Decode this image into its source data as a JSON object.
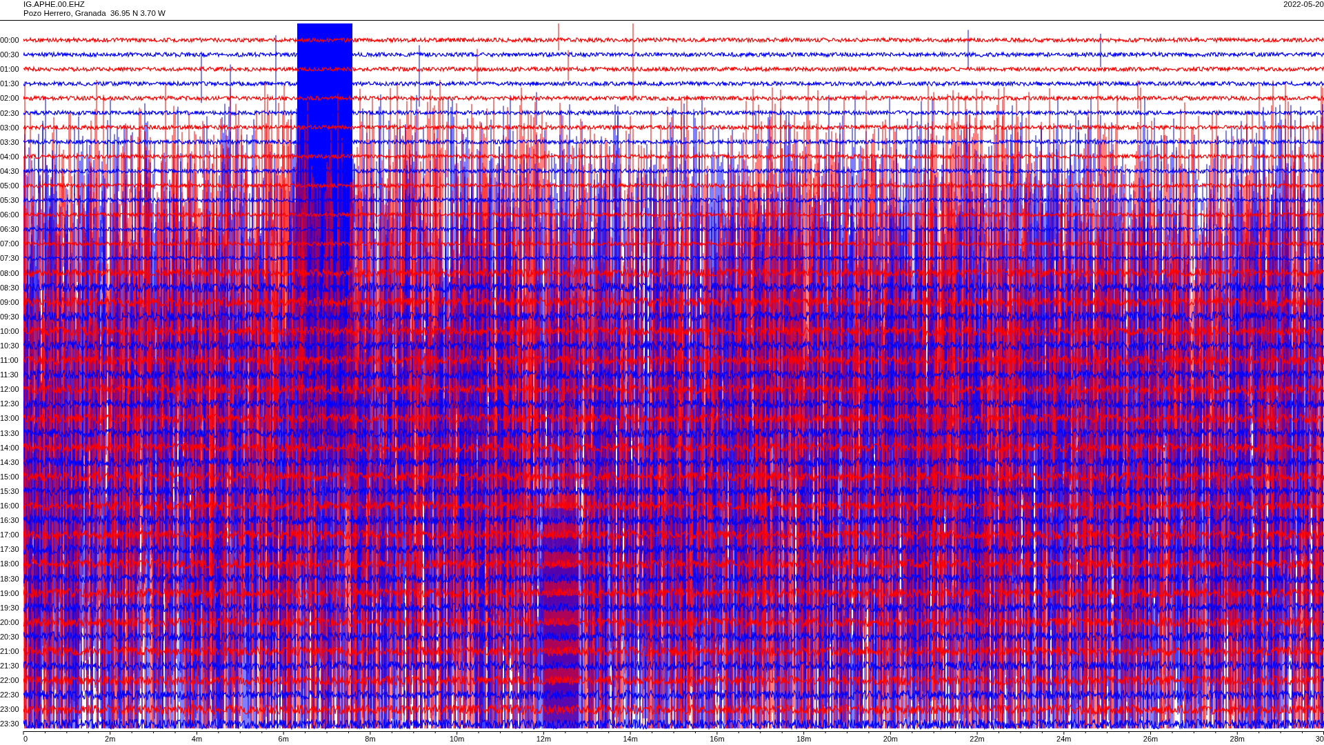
{
  "header": {
    "station": "IG.APHE.00.EHZ",
    "location": "Pozo Herrero, Granada  36.95 N 3.70 W",
    "date": "2022-05-20"
  },
  "traces": [
    {
      "time": "00:00",
      "color": "#ff0000"
    },
    {
      "time": "00:30",
      "color": "#0000ff"
    },
    {
      "time": "01:00",
      "color": "#ff0000"
    },
    {
      "time": "01:30",
      "color": "#0000ff"
    },
    {
      "time": "02:00",
      "color": "#ff0000"
    },
    {
      "time": "02:30",
      "color": "#0000ff"
    },
    {
      "time": "03:00",
      "color": "#ff0000"
    },
    {
      "time": "03:30",
      "color": "#0000ff"
    },
    {
      "time": "04:00",
      "color": "#ff0000"
    },
    {
      "time": "04:30",
      "color": "#0000ff"
    },
    {
      "time": "05:00",
      "color": "#ff0000"
    },
    {
      "time": "05:30",
      "color": "#0000ff"
    },
    {
      "time": "06:00",
      "color": "#ff0000"
    },
    {
      "time": "06:30",
      "color": "#0000ff"
    },
    {
      "time": "07:00",
      "color": "#ff0000"
    },
    {
      "time": "07:30",
      "color": "#0000ff"
    },
    {
      "time": "08:00",
      "color": "#ff0000"
    },
    {
      "time": "08:30",
      "color": "#0000ff"
    },
    {
      "time": "09:00",
      "color": "#ff0000"
    },
    {
      "time": "09:30",
      "color": "#0000ff"
    },
    {
      "time": "10:00",
      "color": "#ff0000"
    },
    {
      "time": "10:30",
      "color": "#0000ff"
    },
    {
      "time": "11:00",
      "color": "#ff0000"
    },
    {
      "time": "11:30",
      "color": "#0000ff"
    },
    {
      "time": "12:00",
      "color": "#ff0000"
    },
    {
      "time": "12:30",
      "color": "#0000ff"
    },
    {
      "time": "13:00",
      "color": "#ff0000"
    },
    {
      "time": "13:30",
      "color": "#0000ff"
    },
    {
      "time": "14:00",
      "color": "#ff0000"
    },
    {
      "time": "14:30",
      "color": "#0000ff"
    },
    {
      "time": "15:00",
      "color": "#ff0000"
    },
    {
      "time": "15:30",
      "color": "#0000ff"
    },
    {
      "time": "16:00",
      "color": "#ff0000"
    },
    {
      "time": "16:30",
      "color": "#0000ff"
    },
    {
      "time": "17:00",
      "color": "#ff0000"
    },
    {
      "time": "17:30",
      "color": "#0000ff"
    },
    {
      "time": "18:00",
      "color": "#ff0000"
    },
    {
      "time": "18:30",
      "color": "#0000ff"
    },
    {
      "time": "19:00",
      "color": "#ff0000"
    },
    {
      "time": "19:30",
      "color": "#0000ff"
    },
    {
      "time": "20:00",
      "color": "#ff0000"
    },
    {
      "time": "20:30",
      "color": "#0000ff"
    },
    {
      "time": "21:00",
      "color": "#ff0000"
    },
    {
      "time": "21:30",
      "color": "#0000ff"
    },
    {
      "time": "22:00",
      "color": "#ff0000"
    },
    {
      "time": "22:30",
      "color": "#0000ff"
    },
    {
      "time": "23:00",
      "color": "#ff0000"
    },
    {
      "time": "23:30",
      "color": "#0000ff"
    }
  ],
  "x_axis": {
    "labels": [
      "0",
      "2m",
      "4m",
      "6m",
      "8m",
      "10m",
      "12m",
      "14m",
      "16m",
      "18m",
      "20m",
      "22m",
      "24m",
      "26m",
      "28m",
      "30"
    ]
  }
}
